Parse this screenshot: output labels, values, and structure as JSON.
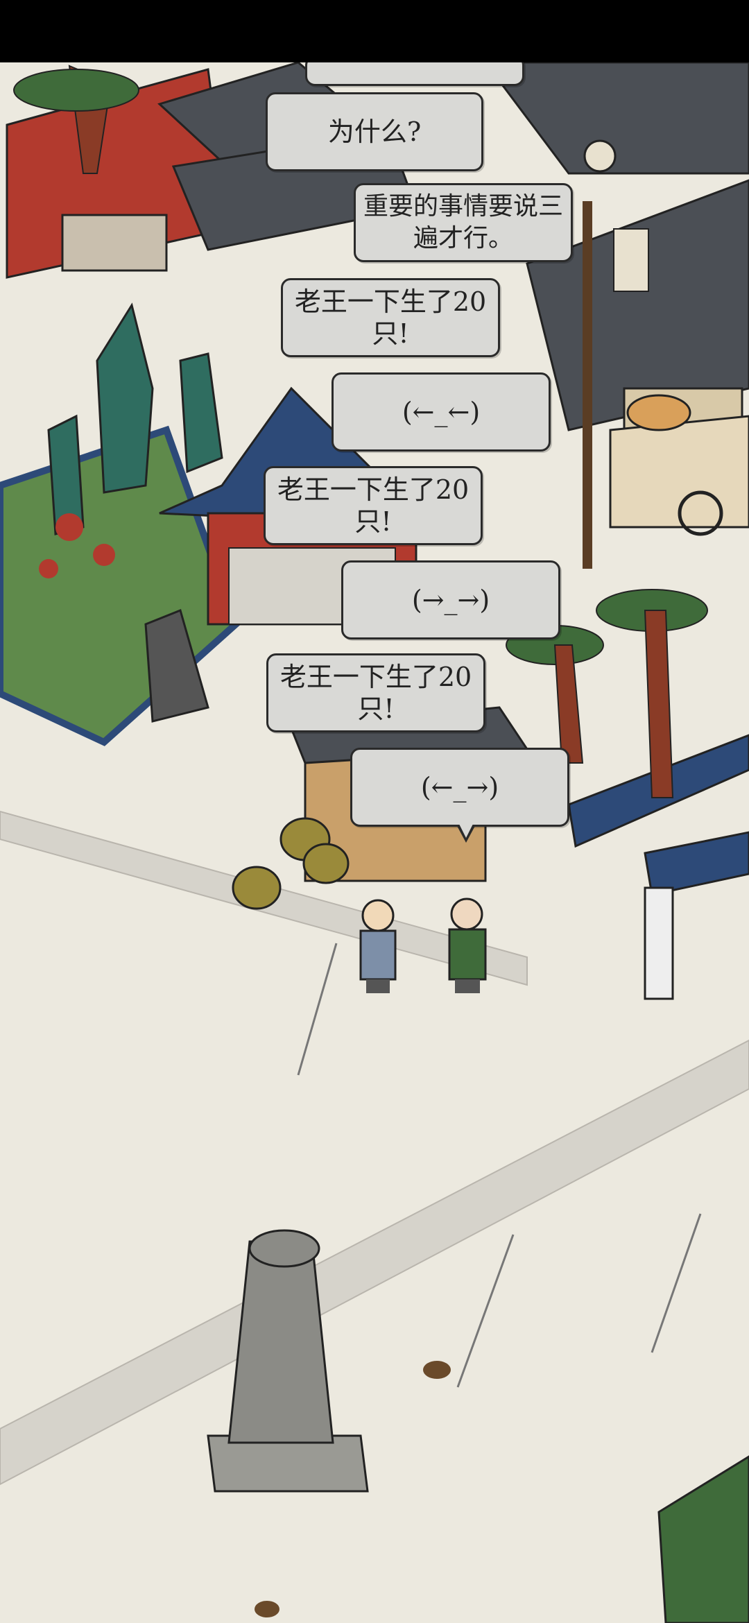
{
  "dialogue": [
    {
      "text": "为什么?"
    },
    {
      "text": "重要的事情要说三遍才行。"
    },
    {
      "text": "老王一下生了20只!"
    },
    {
      "text": "(←_←)"
    },
    {
      "text": "老王一下生了20只!"
    },
    {
      "text": "(→_→)"
    },
    {
      "text": "老王一下生了20只!"
    },
    {
      "text": "(←_→)"
    }
  ],
  "colors": {
    "ground": "#ece9df",
    "roof": "#4b4f55",
    "roof_blue": "#2d4a78",
    "wall_red": "#b23a2e",
    "pine": "#3f6b3a",
    "rock_teal": "#2f6d60",
    "bubble": "#d9d9d6"
  },
  "icons": {
    "npc_left": "villager-woman-icon",
    "npc_right": "old-woman-icon",
    "statue": "stone-statue-icon",
    "hedgehog": "hedgehog-icon"
  }
}
